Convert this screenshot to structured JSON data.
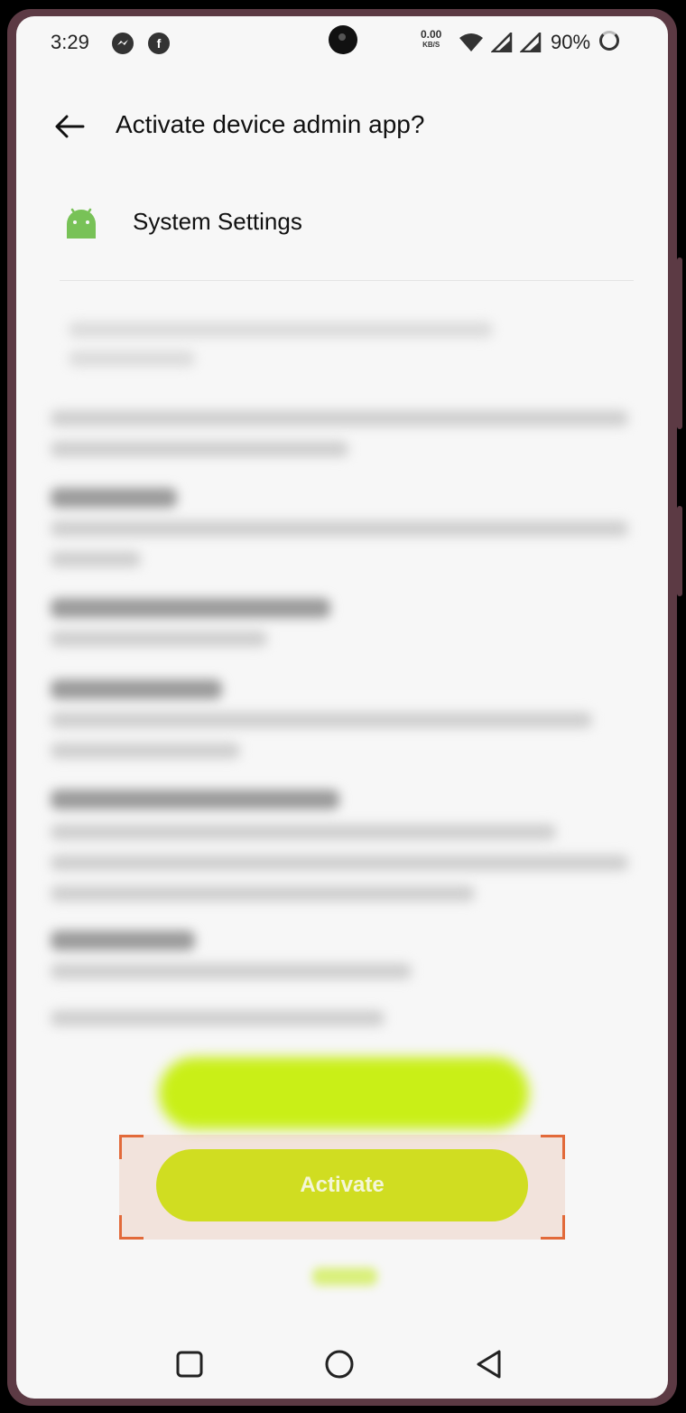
{
  "status_bar": {
    "time": "3:29",
    "notification_icons": [
      "messenger-icon",
      "facebook-icon"
    ],
    "net_speed_value": "0.00",
    "net_speed_unit": "KB/S",
    "battery": "90%"
  },
  "header": {
    "title": "Activate device admin app?",
    "back_icon": "arrow-left-icon"
  },
  "app": {
    "name": "System Settings",
    "icon": "android-icon",
    "icon_color": "#78c257"
  },
  "buttons": {
    "activate_label": "Activate",
    "activate_color": "#d0dd21",
    "blurred_button_color": "#c9ef17"
  },
  "highlight": {
    "corner_color": "#e26a3a"
  },
  "nav_bar": {
    "items": [
      "recents-icon",
      "home-icon",
      "back-icon"
    ]
  }
}
